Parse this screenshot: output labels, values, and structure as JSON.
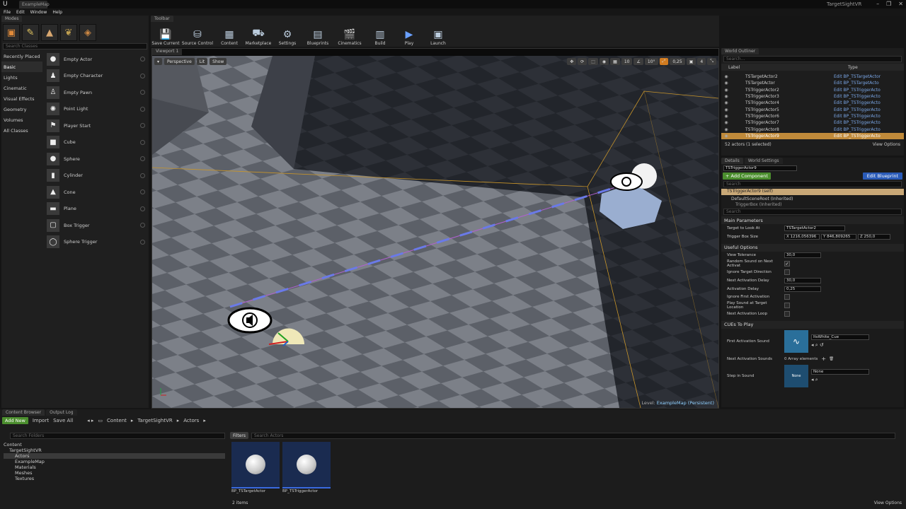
{
  "window": {
    "app_tab": "ExampleMap",
    "project": "TargetSightVR",
    "menu": [
      "File",
      "Edit",
      "Window",
      "Help"
    ]
  },
  "modes": {
    "tab": "Modes",
    "search_placeholder": "Search Classes",
    "categories": [
      "Recently Placed",
      "Basic",
      "Lights",
      "Cinematic",
      "Visual Effects",
      "Geometry",
      "Volumes",
      "All Classes"
    ],
    "items": [
      "Empty Actor",
      "Empty Character",
      "Empty Pawn",
      "Point Light",
      "Player Start",
      "Cube",
      "Sphere",
      "Cylinder",
      "Cone",
      "Plane",
      "Box Trigger",
      "Sphere Trigger"
    ]
  },
  "toolbar": {
    "tab": "Toolbar",
    "buttons": [
      "Save Current",
      "Source Control",
      "Content",
      "Marketplace",
      "Settings",
      "Blueprints",
      "Cinematics",
      "Build",
      "Play",
      "Launch"
    ]
  },
  "viewport": {
    "tab": "Viewport 1",
    "perspective": "Perspective",
    "lit": "Lit",
    "show": "Show",
    "grid_snap": "10",
    "rot_snap": "10°",
    "scale_snap": "0,25",
    "cam_speed": "4",
    "level_label": "Level:",
    "level_name": "ExampleMap (Persistent)"
  },
  "outliner": {
    "tab": "World Outliner",
    "search_placeholder": "Search...",
    "col_label": "Label",
    "col_type": "Type",
    "rows": [
      {
        "label": "TSTargetActor2",
        "type": "Edit BP_TSTargetActor"
      },
      {
        "label": "TSTargetActor",
        "type": "Edit BP_TSTargetActo"
      },
      {
        "label": "TSTriggerActor2",
        "type": "Edit BP_TSTriggerActo"
      },
      {
        "label": "TSTriggerActor3",
        "type": "Edit BP_TSTriggerActo"
      },
      {
        "label": "TSTriggerActor4",
        "type": "Edit BP_TSTriggerActo"
      },
      {
        "label": "TSTriggerActor5",
        "type": "Edit BP_TSTriggerActo"
      },
      {
        "label": "TSTriggerActor6",
        "type": "Edit BP_TSTriggerActo"
      },
      {
        "label": "TSTriggerActor7",
        "type": "Edit BP_TSTriggerActo"
      },
      {
        "label": "TSTriggerActor8",
        "type": "Edit BP_TSTriggerActo"
      },
      {
        "label": "TSTriggerActor9",
        "type": "Edit BP_TSTriggerActo"
      }
    ],
    "count": "52 actors (1 selected)",
    "view_options": "View Options"
  },
  "details": {
    "tab": "Details",
    "tab2": "World Settings",
    "name": "TSTriggerActor9",
    "add_component": "+ Add Component",
    "edit_blueprint": "Edit Blueprint",
    "comp_search_placeholder": "Search",
    "comp_self": "TSTriggerActor9 (self)",
    "comp_root": "DefaultSceneRoot (Inherited)",
    "comp_trigger": "TriggerBox (Inherited)",
    "search_placeholder": "Search",
    "main_section": "Main Parameters",
    "target_label": "Target to Look At",
    "target_value": "TSTargetActor2",
    "trigger_label": "Trigger Box Size",
    "trig_x": "X 1216,056396",
    "trig_y": "Y 846,809265",
    "trig_z": "Z 250,0",
    "useful_section": "Useful Options",
    "view_tolerance_label": "View Tolerance",
    "view_tolerance": "30,0",
    "random_sound_label": "Random Sound on Next Activat",
    "ignore_dir_label": "Ignore Target Direction",
    "next_delay_label": "Next Activation Delay",
    "next_delay": "30,0",
    "act_delay_label": "Activation Delay",
    "act_delay": "0,25",
    "ignore_first_label": "Ignore First Activation",
    "play_at_target_label": "Play Sound at Target Location",
    "next_loop_label": "Next Activation Loop",
    "cues_section": "CUEs To Play",
    "first_sound_label": "First Activation Sound",
    "first_sound_value": "ItsWhite_Cue",
    "next_sounds_label": "Next Activation Sounds",
    "next_sounds_value": "0 Array elements",
    "step_sound_label": "Step in Sound",
    "step_sound_value": "None",
    "step_thumb": "None"
  },
  "content": {
    "tab": "Content Browser",
    "tab2": "Output Log",
    "add_new": "Add New",
    "import": "Import",
    "save_all": "Save All",
    "path": [
      "Content",
      "TargetSightVR",
      "Actors"
    ],
    "search_folders": "Search Folders",
    "filters": "Filters",
    "search_assets": "Search Actors",
    "tree": [
      "Content",
      "TargetSightVR",
      "Actors",
      "ExampleMap",
      "Materials",
      "Meshes",
      "Textures"
    ],
    "assets": [
      "BP_TSTargetActor",
      "BP_TSTriggerActor"
    ],
    "count": "2 items",
    "view_options": "View Options"
  }
}
